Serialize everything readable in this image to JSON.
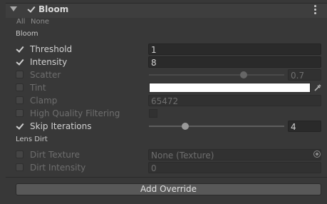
{
  "header": {
    "title": "Bloom",
    "enabled": true
  },
  "toggles": {
    "all": "All",
    "none": "None"
  },
  "sections": {
    "bloom": "Bloom",
    "lens_dirt": "Lens Dirt"
  },
  "bloom": {
    "threshold": {
      "label": "Threshold",
      "value": "1",
      "override": true
    },
    "intensity": {
      "label": "Intensity",
      "value": "8",
      "override": true
    },
    "scatter": {
      "label": "Scatter",
      "value": "0.7",
      "override": false,
      "slider_fraction": 0.7
    },
    "tint": {
      "label": "Tint",
      "override": false,
      "color": "#ffffff"
    },
    "clamp": {
      "label": "Clamp",
      "value": "65472",
      "override": false
    },
    "high_quality_filtering": {
      "label": "High Quality Filtering",
      "override": false,
      "checked": false
    },
    "skip_iterations": {
      "label": "Skip Iterations",
      "value": "4",
      "override": true,
      "slider_fraction": 0.28
    }
  },
  "lens_dirt": {
    "dirt_texture": {
      "label": "Dirt Texture",
      "value": "None (Texture)",
      "override": false
    },
    "dirt_intensity": {
      "label": "Dirt Intensity",
      "value": "0",
      "override": false
    }
  },
  "add_override_label": "Add Override",
  "colors": {
    "background": "#383838",
    "field": "#2a2a2a",
    "button": "#585858"
  }
}
